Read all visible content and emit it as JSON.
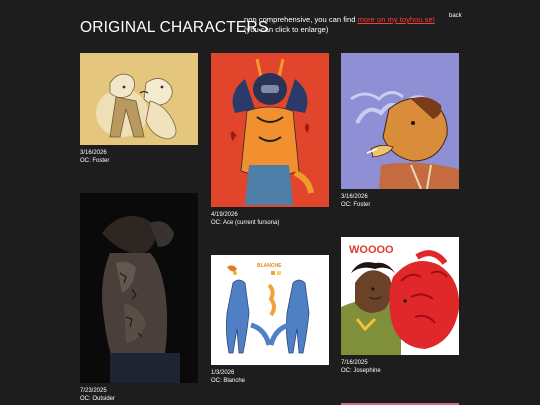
{
  "header": {
    "title": "ORIGINAL CHARACTERS",
    "intro_prefix": "non comprehensive, you can find ",
    "intro_link": "more on my toyhou.se!",
    "intro_line2": "(you can click to enlarge)",
    "back_label": "back"
  },
  "gallery": [
    {
      "date": "3/16/2026",
      "oc": "OC: Foster"
    },
    {
      "date": "4/19/2026",
      "oc": "OC: Ace (current fursona)"
    },
    {
      "date": "3/16/2026",
      "oc": "OC: Foster"
    },
    {
      "date": "7/23/2025",
      "oc": "OC: Outsider"
    },
    {
      "date": "1/3/2026",
      "oc": "OC: Blanche"
    },
    {
      "date": "7/16/2025",
      "oc": "OC: Josephine"
    }
  ],
  "art_text": {
    "blanche_label": "BLANCHE",
    "speech_text": "WOOOO"
  },
  "colors": {
    "background": "#1d1d1d",
    "text": "#ffffff",
    "link": "#ff3b3b"
  }
}
